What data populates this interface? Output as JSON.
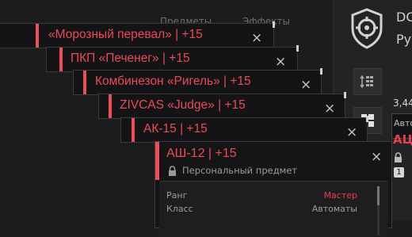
{
  "background": {
    "tabs": [
      "Предметы",
      "Эффекты"
    ],
    "right_panel": {
      "title": "DC",
      "subtitle": "Ру",
      "number": "3,44",
      "box_label": "Авто",
      "red_text": "АЦ",
      "badge": "1"
    }
  },
  "notifications": [
    {
      "text": "«Морозный перевал» | +15",
      "close": "×"
    },
    {
      "text": "ПКП «Печенег» | +15",
      "close": "×"
    },
    {
      "text": "Комбинезон «Ригель» | +15",
      "close": "×"
    },
    {
      "text": "ZIVCAS «Judge» | +15",
      "close": "×"
    },
    {
      "text": "АК-15 | +15",
      "close": "×"
    }
  ],
  "main_card": {
    "title": "АШ-12 | +15",
    "close": "×",
    "subtitle": "Персональный предмет",
    "stats": [
      {
        "label": "Ранг",
        "value": "Мастер",
        "accent": true
      },
      {
        "label": "Класс",
        "value": "Автоматы",
        "accent": false
      }
    ]
  },
  "colors": {
    "accent": "#ec4f5c",
    "background": "#1c1c1e",
    "card": "#141416"
  }
}
